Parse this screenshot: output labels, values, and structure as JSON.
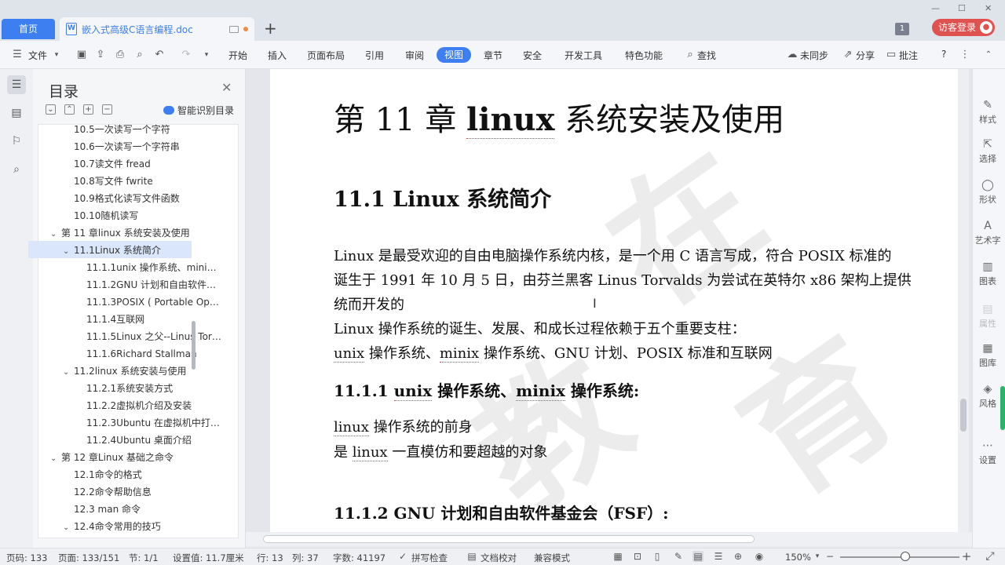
{
  "tabs": {
    "home": "首页",
    "doc": "嵌入式高级C语言编程.doc",
    "add": "+"
  },
  "window": {
    "minimize": "—",
    "maximize": "☐",
    "close": "✕",
    "badge": "1",
    "login": "访客登录"
  },
  "menu": {
    "file": "文件",
    "items": [
      "开始",
      "插入",
      "页面布局",
      "引用",
      "审阅"
    ],
    "view": "视图",
    "items2": [
      "章节",
      "安全",
      "开发工具",
      "特色功能"
    ],
    "search": "查找",
    "sync": "未同步",
    "share": "分享",
    "comment": "批注",
    "help": "?"
  },
  "toc": {
    "title": "目录",
    "smart": "智能识别目录",
    "items": [
      {
        "label": "10.5一次读写一个字符",
        "indent": 2,
        "arrow": ""
      },
      {
        "label": "10.6一次读写一个字符串",
        "indent": 2,
        "arrow": ""
      },
      {
        "label": "10.7读文件 fread",
        "indent": 2,
        "arrow": ""
      },
      {
        "label": "10.8写文件 fwrite",
        "indent": 2,
        "arrow": ""
      },
      {
        "label": "10.9格式化读写文件函数",
        "indent": 2,
        "arrow": ""
      },
      {
        "label": "10.10随机读写",
        "indent": 2,
        "arrow": ""
      },
      {
        "label": "第 11 章linux 系统安装及使用",
        "indent": 1,
        "arrow": "v"
      },
      {
        "label": "11.1Linux 系统简介",
        "indent": 2,
        "arrow": "v"
      },
      {
        "label": "11.1.1unix 操作系统、mini…",
        "indent": 3,
        "arrow": ""
      },
      {
        "label": "11.1.2GNU 计划和自由软件…",
        "indent": 3,
        "arrow": ""
      },
      {
        "label": "11.1.3POSIX ( Portable Op…",
        "indent": 3,
        "arrow": ""
      },
      {
        "label": "11.1.4互联网",
        "indent": 3,
        "arrow": ""
      },
      {
        "label": "11.1.5Linux 之父--Linus Tor…",
        "indent": 3,
        "arrow": ""
      },
      {
        "label": "11.1.6Richard Stallman",
        "indent": 3,
        "arrow": ""
      },
      {
        "label": "11.2linux 系统安装与使用",
        "indent": 2,
        "arrow": "v"
      },
      {
        "label": "11.2.1系统安装方式",
        "indent": 3,
        "arrow": ""
      },
      {
        "label": "11.2.2虚拟机介绍及安装",
        "indent": 3,
        "arrow": ""
      },
      {
        "label": "11.2.3Ubuntu 在虚拟机中打…",
        "indent": 3,
        "arrow": ""
      },
      {
        "label": "11.2.4Ubuntu 桌面介绍",
        "indent": 3,
        "arrow": ""
      },
      {
        "label": "第 12 章Linux 基础之命令",
        "indent": 1,
        "arrow": "v"
      },
      {
        "label": "12.1命令的格式",
        "indent": 2,
        "arrow": ""
      },
      {
        "label": "12.2命令帮助信息",
        "indent": 2,
        "arrow": ""
      },
      {
        "label": "12.3  man 命令",
        "indent": 2,
        "arrow": ""
      },
      {
        "label": "12.4命令常用的技巧",
        "indent": 2,
        "arrow": "v"
      }
    ]
  },
  "doc": {
    "h1": {
      "a": "第 11 章  ",
      "b": "linux",
      "c": " 系统安装及使用"
    },
    "h2": "11.1  Linux 系统简介",
    "p1": "Linux 是最受欢迎的自由电脑操作系统内核，是一个用 C 语言写成，符合 POSIX 标准的",
    "p2": "诞生于 1991 年 10 月 5 日，由芬兰黑客 Linus Torvalds 为尝试在英特尔 x86 架构上提供",
    "p3": "统而开发的",
    "p4": "Linux 操作系统的诞生、发展、和成长过程依赖于五个重要支柱：",
    "p5a": "unix",
    "p5b": " 操作系统、",
    "p5c": "minix",
    "p5d": " 操作系统、GNU 计划、POSIX 标准和互联网",
    "h3a": {
      "a": "11.1.1  ",
      "b": "unix",
      "c": " 操作系统、",
      "d": "minix",
      "e": " 操作系统:"
    },
    "p6a": "linux",
    "p6b": " 操作系统的前身",
    "p7a": "是 ",
    "p7b": "linux",
    "p7c": " 一直模仿和要超越的对象",
    "h3b": "11.1.2  GNU 计划和自由软件基金会（FSF）:"
  },
  "rightrail": [
    {
      "label": "样式",
      "icon": "✎",
      "dim": false
    },
    {
      "label": "选择",
      "icon": "⇱",
      "dim": false
    },
    {
      "label": "形状",
      "icon": "◯",
      "dim": false
    },
    {
      "label": "艺术字",
      "icon": "A",
      "dim": false
    },
    {
      "label": "图表",
      "icon": "▥",
      "dim": false
    },
    {
      "label": "属性",
      "icon": "▤",
      "dim": true
    },
    {
      "label": "图库",
      "icon": "▦",
      "dim": false
    },
    {
      "label": "风格",
      "icon": "◈",
      "dim": false
    },
    {
      "label": "设置",
      "icon": "⋯",
      "dim": false
    }
  ],
  "status": {
    "page": "页码: 133",
    "pages": "页面: 133/151",
    "section": "节: 1/1",
    "setting": "设置值: 11.7厘米",
    "row": "行: 13",
    "col": "列: 37",
    "words": "字数: 41197",
    "spell": "拼写检查",
    "proof": "文档校对",
    "compat": "兼容模式",
    "zoom": "150%"
  }
}
